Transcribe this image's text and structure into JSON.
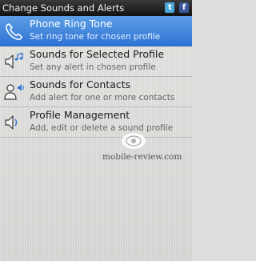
{
  "header": {
    "title": "Change Sounds and Alerts",
    "icons": [
      "twitter-icon",
      "facebook-icon"
    ]
  },
  "menu": {
    "items": [
      {
        "label": "Phone Ring Tone",
        "subtitle": "Set ring tone for chosen profile",
        "icon": "phone-icon",
        "selected": true
      },
      {
        "label": "Sounds for Selected Profile",
        "subtitle": "Set any alert in chosen profile",
        "icon": "speaker-music-icon",
        "selected": false
      },
      {
        "label": "Sounds for Contacts",
        "subtitle": "Add alert for one or more contacts",
        "icon": "contact-sound-icon",
        "selected": false
      },
      {
        "label": "Profile Management",
        "subtitle": "Add, edit or delete a sound profile",
        "icon": "speaker-icon",
        "selected": false
      }
    ]
  },
  "watermark": {
    "text": "mobile-review.com"
  },
  "colors": {
    "selection": "#2f73d4",
    "titlebar": "#121212",
    "background": "#dedfdc"
  }
}
